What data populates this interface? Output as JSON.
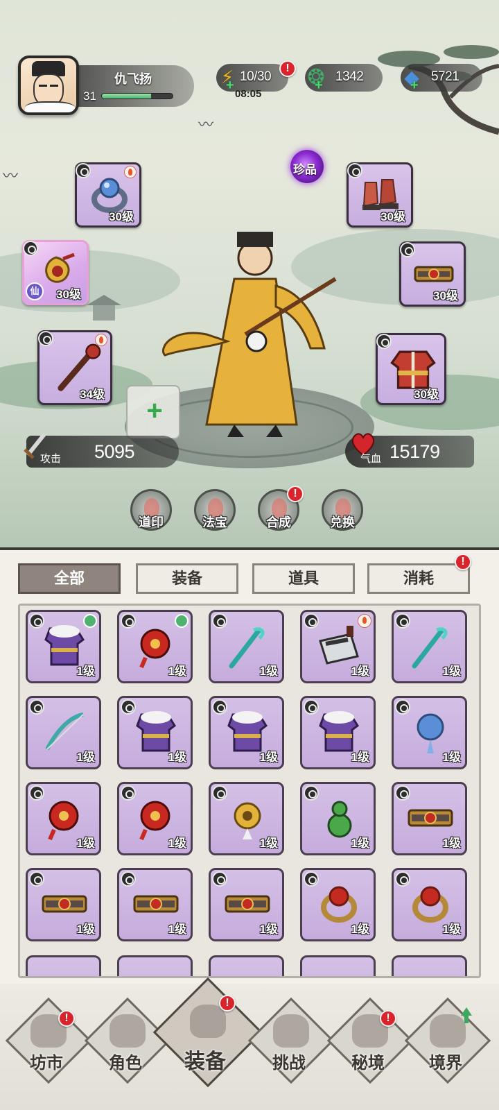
{
  "player": {
    "name": "仇飞扬",
    "level": "31",
    "xp_fraction": 0.7
  },
  "resources": {
    "energy": {
      "value": "10/30",
      "timer": "08:05",
      "icon": "lightning-icon",
      "alert": "!"
    },
    "jade": {
      "value": "1342",
      "icon": "jade-icon"
    },
    "crystal": {
      "value": "5721",
      "icon": "crystal-icon"
    }
  },
  "rarity_label": "珍品",
  "equipped": {
    "ring": "30级",
    "boots": "30级",
    "amulet": "30级",
    "amulet_badge": "仙",
    "belt": "30级",
    "weapon": "34级",
    "armor": "30级"
  },
  "stats": {
    "attack_label": "攻击",
    "attack_value": "5095",
    "hp_label": "气血",
    "hp_value": "15179"
  },
  "functions": [
    {
      "label": "道印",
      "alert": false
    },
    {
      "label": "法宝",
      "alert": false
    },
    {
      "label": "合成",
      "alert": true
    },
    {
      "label": "兑换",
      "alert": false
    }
  ],
  "alert_glyph": "!",
  "tabs": [
    {
      "label": "全部",
      "active": true
    },
    {
      "label": "装备",
      "active": false
    },
    {
      "label": "道具",
      "active": false
    },
    {
      "label": "消耗",
      "active": false,
      "alert": true
    }
  ],
  "inventory": [
    {
      "name": "fur-robe",
      "level": "1级",
      "badge": "green"
    },
    {
      "name": "red-pendant",
      "level": "1级",
      "badge": "green"
    },
    {
      "name": "jade-hairpin",
      "level": "1级",
      "badge": ""
    },
    {
      "name": "cleaver",
      "level": "1级",
      "badge": "fire"
    },
    {
      "name": "jade-hairpin",
      "level": "1级",
      "badge": ""
    },
    {
      "name": "jade-bow",
      "level": "1级",
      "badge": ""
    },
    {
      "name": "blue-robe",
      "level": "1级",
      "badge": ""
    },
    {
      "name": "purple-fur-robe",
      "level": "1级",
      "badge": ""
    },
    {
      "name": "green-robe",
      "level": "1级",
      "badge": ""
    },
    {
      "name": "blue-amulet",
      "level": "1级",
      "badge": ""
    },
    {
      "name": "red-coin-pendant",
      "level": "1级",
      "badge": ""
    },
    {
      "name": "red-knot-pendant",
      "level": "1级",
      "badge": ""
    },
    {
      "name": "gold-medallion",
      "level": "1级",
      "badge": ""
    },
    {
      "name": "green-gourd",
      "level": "1级",
      "badge": ""
    },
    {
      "name": "taiji-belt",
      "level": "1级",
      "badge": ""
    },
    {
      "name": "red-belt",
      "level": "1级",
      "badge": ""
    },
    {
      "name": "red-belt",
      "level": "1级",
      "badge": ""
    },
    {
      "name": "purple-belt",
      "level": "1级",
      "badge": ""
    },
    {
      "name": "ruby-ring",
      "level": "1级",
      "badge": ""
    },
    {
      "name": "ruby-ring",
      "level": "1级",
      "badge": ""
    }
  ],
  "nav": [
    {
      "label": "坊市",
      "alert": true
    },
    {
      "label": "角色",
      "alert": false
    },
    {
      "label": "装备",
      "alert": true,
      "active": true
    },
    {
      "label": "挑战",
      "alert": false
    },
    {
      "label": "秘境",
      "alert": true
    },
    {
      "label": "境界",
      "alert": false,
      "upgrade": true
    }
  ]
}
